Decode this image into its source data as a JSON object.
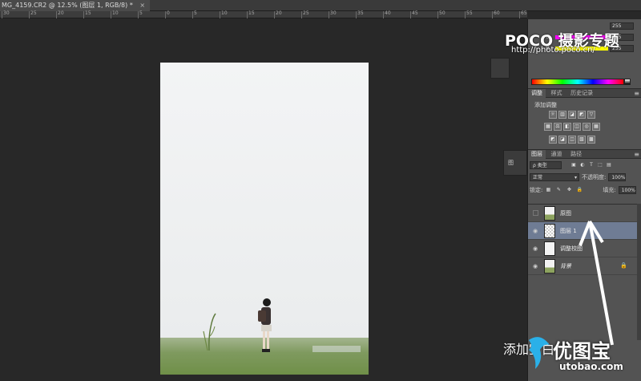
{
  "document": {
    "tab_title": "MG_4159.CR2 @ 12.5% (图层 1, RGB/8) *",
    "close": "×",
    "ruler_numbers": [
      "30",
      "25",
      "20",
      "15",
      "10",
      "5",
      "0",
      "5",
      "10",
      "15",
      "20",
      "25",
      "30",
      "35",
      "40",
      "45",
      "50",
      "55",
      "60",
      "65"
    ]
  },
  "watermark": {
    "poco": "POCO 摄影专题",
    "url": "http://photo.poco.cn/"
  },
  "color_panel": {
    "rows": [
      {
        "label": "G",
        "value": "255",
        "color": "#ff00ff"
      },
      {
        "label": "B",
        "value": "255",
        "color": "#ffff00"
      }
    ],
    "top_value": "255"
  },
  "adjustments_panel": {
    "tabs": [
      "调整",
      "样式",
      "历史记录"
    ],
    "menu": "≡",
    "title": "添加调整",
    "row1": [
      "☼",
      "▥",
      "◪",
      "◩",
      "▽"
    ],
    "row2": [
      "▦",
      "⚖",
      "◧",
      "◫",
      "◎",
      "▦"
    ],
    "row3": [
      "◩",
      "◪",
      "◫",
      "▧",
      "▩"
    ]
  },
  "mini_strip": {
    "label": "图"
  },
  "layers_panel": {
    "tabs": [
      "图层",
      "通道",
      "路径"
    ],
    "menu": "≡",
    "filter_kind": "类型",
    "filter_icons": [
      "▣",
      "◐",
      "T",
      "⬚",
      "▤"
    ],
    "blend_mode": "正常",
    "opacity_label": "不透明度:",
    "opacity_value": "100%",
    "lock_label": "锁定:",
    "lock_icons": [
      "▦",
      "✎",
      "✥",
      "🔒"
    ],
    "fill_label": "填充:",
    "fill_value": "100%",
    "layers": [
      {
        "name": "原图",
        "visible": false,
        "thumb": "grass",
        "selected": false,
        "italic": false,
        "locked": false
      },
      {
        "name": "图层 1",
        "visible": true,
        "thumb": "checker",
        "selected": true,
        "italic": false,
        "locked": false
      },
      {
        "name": "调整校图",
        "visible": true,
        "thumb": "plain",
        "selected": false,
        "italic": false,
        "locked": false
      },
      {
        "name": "背景",
        "visible": true,
        "thumb": "grass",
        "selected": false,
        "italic": true,
        "locked": true
      }
    ],
    "eye_icon": "◉",
    "lock_icon": "🔒"
  },
  "caption": {
    "text": "添加空白",
    "logo": "优图宝",
    "logo_url": "utobao.com"
  }
}
